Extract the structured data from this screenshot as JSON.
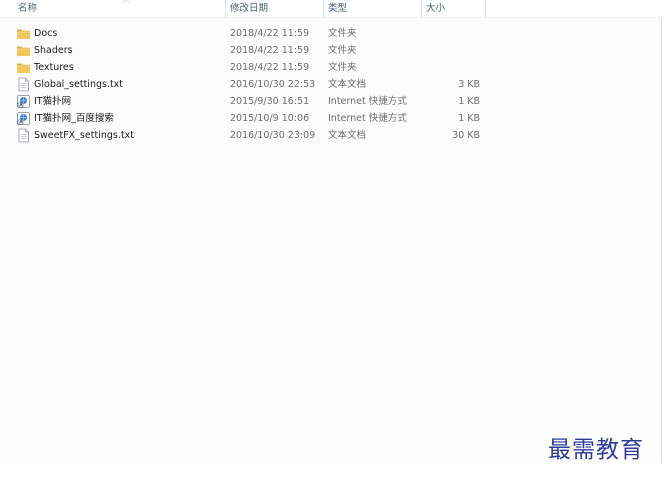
{
  "columns": {
    "name": "名称",
    "date": "修改日期",
    "type": "类型",
    "size": "大小"
  },
  "files": [
    {
      "icon": "folder-icon",
      "name": "Docs",
      "date": "2018/4/22 11:59",
      "type": "文件夹",
      "size": ""
    },
    {
      "icon": "folder-icon",
      "name": "Shaders",
      "date": "2018/4/22 11:59",
      "type": "文件夹",
      "size": ""
    },
    {
      "icon": "folder-icon",
      "name": "Textures",
      "date": "2018/4/22 11:59",
      "type": "文件夹",
      "size": ""
    },
    {
      "icon": "text-file-icon",
      "name": "Global_settings.txt",
      "date": "2016/10/30 22:53",
      "type": "文本文档",
      "size": "3 KB"
    },
    {
      "icon": "internet-shortcut-icon",
      "name": "IT猫扑网",
      "date": "2015/9/30 16:51",
      "type": "Internet 快捷方式",
      "size": "1 KB"
    },
    {
      "icon": "internet-shortcut-icon",
      "name": "IT猫扑网_百度搜索",
      "date": "2015/10/9 10:06",
      "type": "Internet 快捷方式",
      "size": "1 KB"
    },
    {
      "icon": "text-file-icon",
      "name": "SweetFX_settings.txt",
      "date": "2016/10/30 23:09",
      "type": "文本文档",
      "size": "30 KB"
    }
  ],
  "colors": {
    "folder": "#e8b84a",
    "header_text": "#4c607a",
    "watermark": "#2d3d9c"
  },
  "watermark": "最需教育"
}
